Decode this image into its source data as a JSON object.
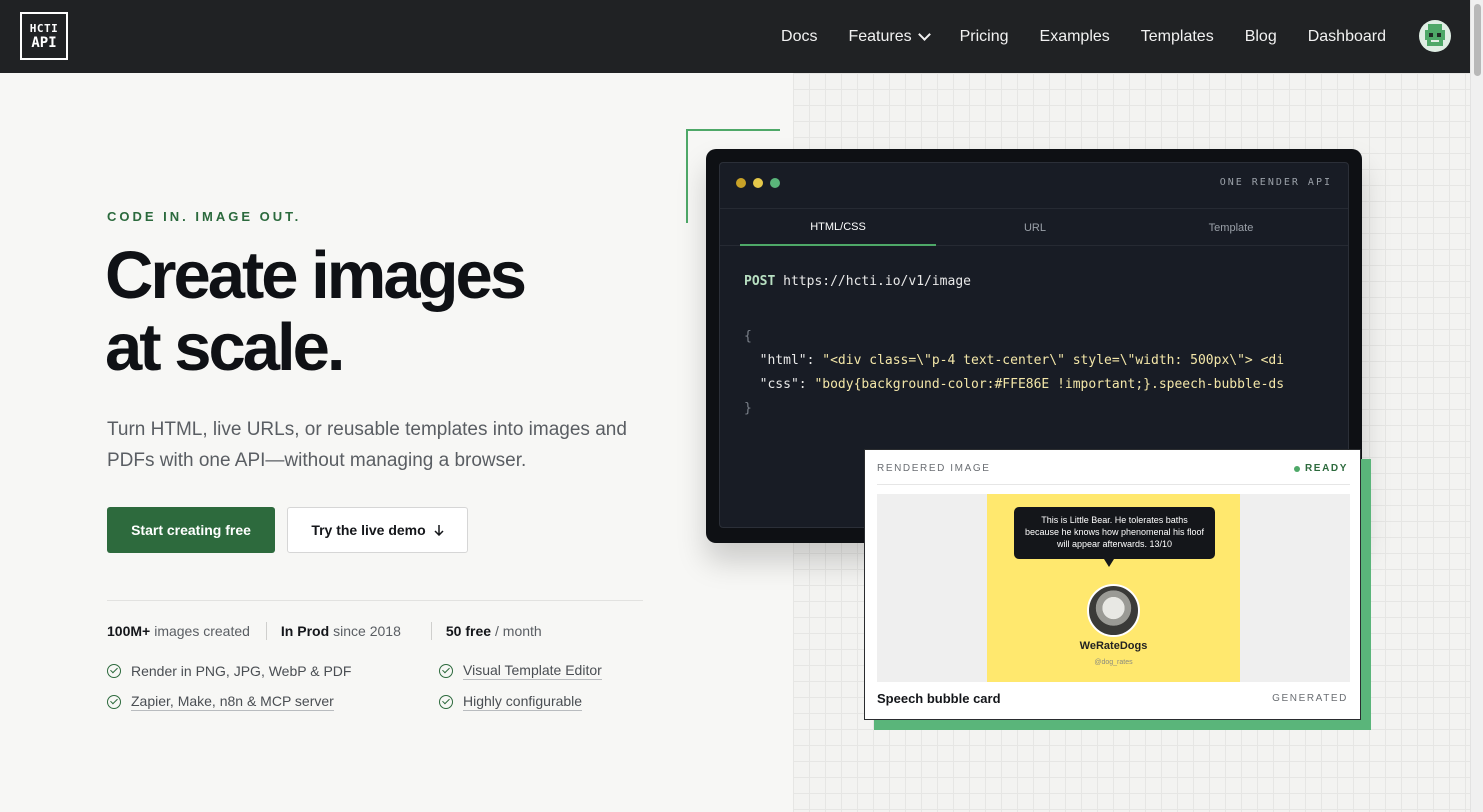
{
  "nav": {
    "logo_line1": "HCTI",
    "logo_line2": "API",
    "links": [
      "Docs",
      "Features",
      "Pricing",
      "Examples",
      "Templates",
      "Blog",
      "Dashboard"
    ]
  },
  "hero": {
    "eyebrow": "CODE IN. IMAGE OUT.",
    "headline_line1": "Create images",
    "headline_line2": "at scale.",
    "subtitle": "Turn HTML, live URLs, or reusable templates into images and PDFs with one API—without managing a browser.",
    "primary_cta": "Start creating free",
    "secondary_cta": "Try the live demo",
    "stats": [
      {
        "value": "100M+",
        "label": "images created"
      },
      {
        "value": "In Prod",
        "label": "since 2018"
      },
      {
        "value": "50 free",
        "label": "/ month"
      }
    ],
    "features": [
      {
        "label": "Render in PNG, JPG, WebP & PDF",
        "link": false
      },
      {
        "label": "Visual Template Editor",
        "link": true
      },
      {
        "label": "Zapier, Make, n8n & MCP server",
        "link": true
      },
      {
        "label": "Highly configurable",
        "link": true
      }
    ]
  },
  "code_window": {
    "title": "ONE RENDER API",
    "tabs": [
      "HTML/CSS",
      "URL",
      "Template"
    ],
    "active_tab": "HTML/CSS",
    "method": "POST",
    "endpoint": "https://hcti.io/v1/image",
    "open_brace": "{",
    "html_key": "\"html\"",
    "html_value": "\"<div class=\\\"p-4 text-center\\\" style=\\\"width: 500px\\\"> <di",
    "css_key": "\"css\"",
    "css_value": "\"body{background-color:#FFE86E !important;}.speech-bubble-ds",
    "close_brace": "}",
    "dot_colors": [
      "#c9a227",
      "#e5c84a",
      "#5ab57a"
    ]
  },
  "rendered_card": {
    "header": "RENDERED IMAGE",
    "status": "READY",
    "bubble_text": "This is Little Bear. He tolerates baths because he knows how phenomenal his floof will appear afterwards. 13/10",
    "profile_name": "WeRateDogs",
    "profile_handle": "@dog_rates",
    "title": "Speech bubble card",
    "footer_status": "GENERATED"
  },
  "colors": {
    "accent_green": "#2d6a3d",
    "highlight_green": "#5ab57a",
    "nav_bg": "#202224",
    "card_yellow": "#ffe86e"
  }
}
